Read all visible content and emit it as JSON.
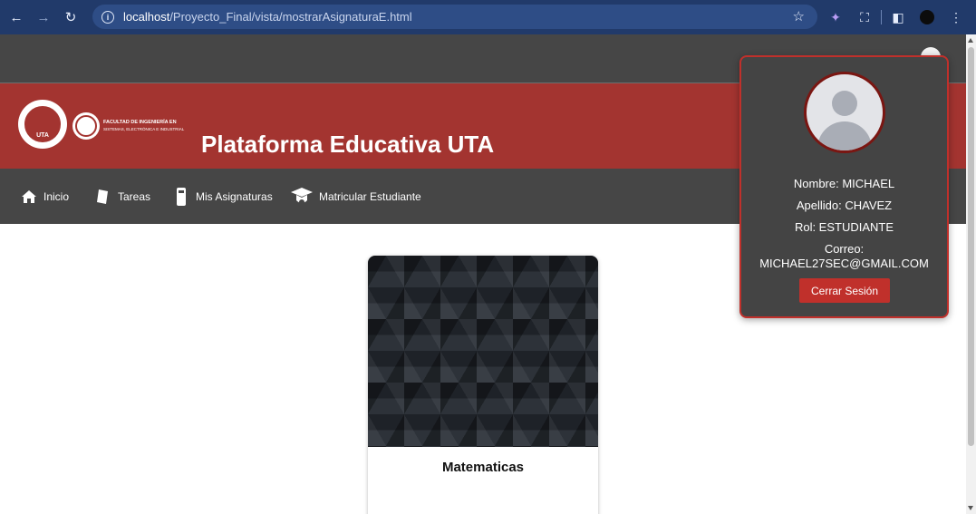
{
  "browser": {
    "url_host": "localhost",
    "url_path": "/Proyecto_Final/vista/mostrarAsignaturaE.html",
    "icons": [
      "back-icon",
      "forward-icon",
      "reload-icon",
      "info-icon",
      "star-icon",
      "extension-icon",
      "puzzle-icon",
      "sidepanel-icon",
      "profile-icon",
      "menu-icon"
    ]
  },
  "header": {
    "logo_university_text": "UTA",
    "faculty_line1": "FACULTAD DE INGENIERÍA EN",
    "faculty_line2": "SISTEMAS, ELECTRÓNICA E INDUSTRIAL",
    "title": "Plataforma Educativa UTA",
    "brand_color": "#a33430"
  },
  "menu": {
    "items": [
      {
        "label": "Inicio",
        "icon": "home-icon"
      },
      {
        "label": "Tareas",
        "icon": "document-icon"
      },
      {
        "label": "Mis Asignaturas",
        "icon": "book-icon"
      },
      {
        "label": "Matricular Estudiante",
        "icon": "graduation-cap-icon"
      }
    ]
  },
  "course_card": {
    "title": "Matematicas"
  },
  "profile_popup": {
    "nombre": "Nombre: MICHAEL",
    "apellido": "Apellido: CHAVEZ",
    "rol": "Rol: ESTUDIANTE",
    "correo_label": "Correo:",
    "correo": "MICHAEL27SEC@GMAIL.COM",
    "logout_label": "Cerrar Sesión"
  }
}
